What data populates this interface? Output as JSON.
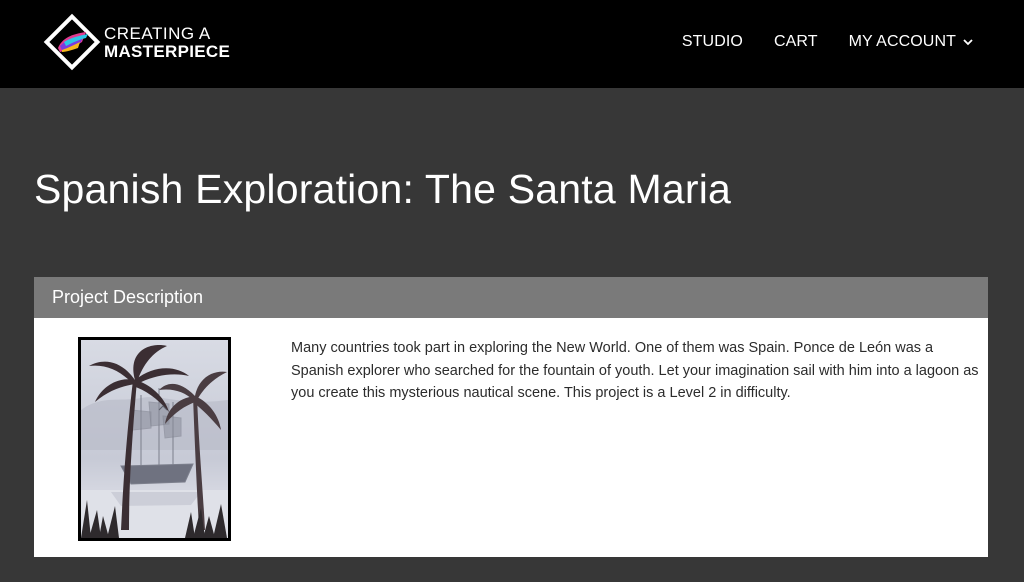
{
  "header": {
    "logo": {
      "line1": "CREATING A",
      "line2": "MASTERPIECE"
    },
    "nav": [
      {
        "label": "STUDIO"
      },
      {
        "label": "CART"
      },
      {
        "label": "MY ACCOUNT",
        "icon": "chevron-down-icon"
      }
    ]
  },
  "main": {
    "title": "Spanish Exploration: The Santa Maria",
    "panel": {
      "header": "Project Description",
      "description": "Many countries took part in exploring the New World. One of them was Spain. Ponce de León was a Spanish explorer who searched for the fountain of youth. Let your imagination sail with him into a lagoon as you create this mysterious nautical scene. This project is a Level 2 in difficulty."
    }
  },
  "colors": {
    "page_background": "#373737",
    "topbar": "#000000",
    "panel_header": "#7a7a7a",
    "panel_body": "#ffffff"
  }
}
